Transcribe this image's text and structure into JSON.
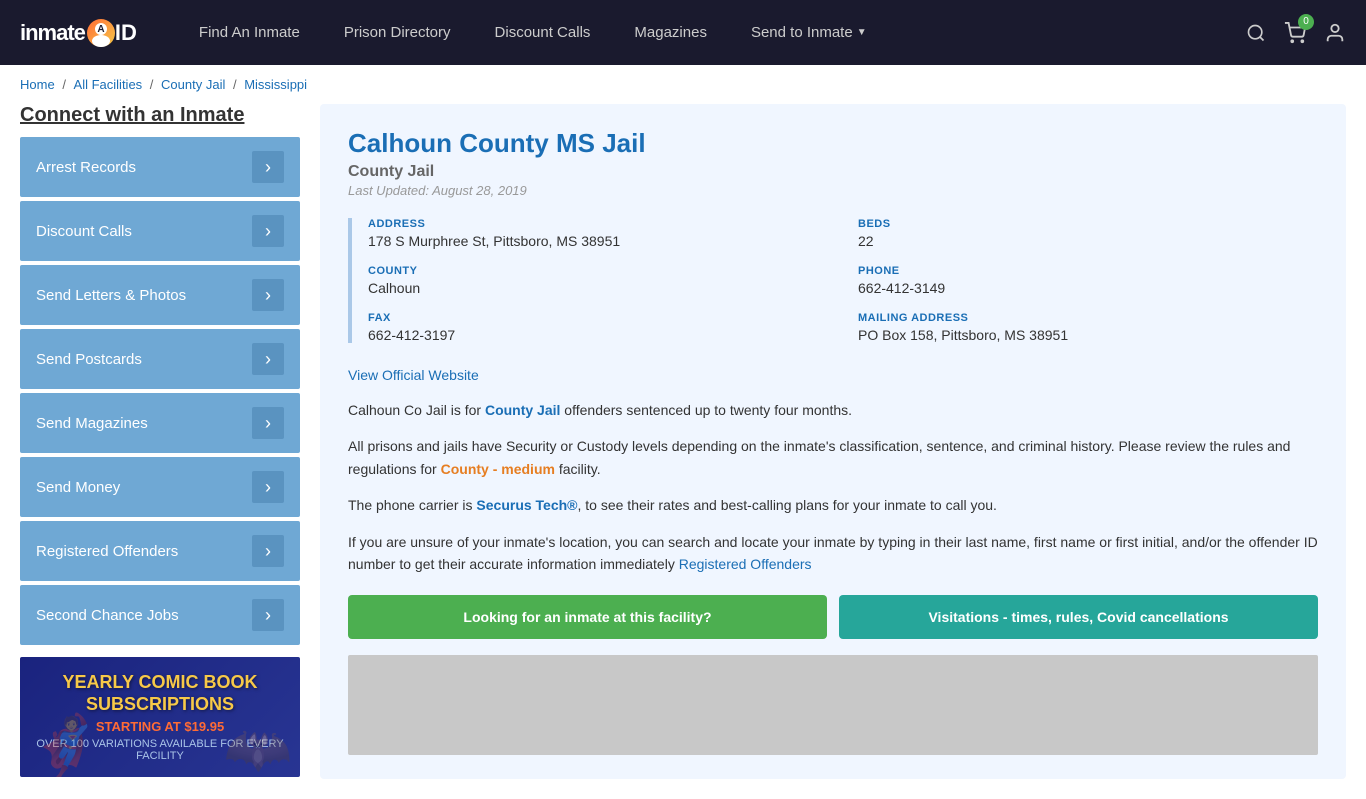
{
  "nav": {
    "logo": "inmateAID",
    "links": [
      {
        "id": "find-inmate",
        "label": "Find An Inmate",
        "arrow": false
      },
      {
        "id": "prison-directory",
        "label": "Prison Directory",
        "arrow": false
      },
      {
        "id": "discount-calls",
        "label": "Discount Calls",
        "arrow": false
      },
      {
        "id": "magazines",
        "label": "Magazines",
        "arrow": false
      },
      {
        "id": "send-to-inmate",
        "label": "Send to Inmate",
        "arrow": true
      }
    ],
    "cart_count": "0"
  },
  "breadcrumb": {
    "home": "Home",
    "all_facilities": "All Facilities",
    "county_jail": "County Jail",
    "state": "Mississippi"
  },
  "sidebar": {
    "title": "Connect with an Inmate",
    "items": [
      {
        "id": "arrest-records",
        "label": "Arrest Records"
      },
      {
        "id": "discount-calls",
        "label": "Discount Calls"
      },
      {
        "id": "send-letters-photos",
        "label": "Send Letters & Photos"
      },
      {
        "id": "send-postcards",
        "label": "Send Postcards"
      },
      {
        "id": "send-magazines",
        "label": "Send Magazines"
      },
      {
        "id": "send-money",
        "label": "Send Money"
      },
      {
        "id": "registered-offenders",
        "label": "Registered Offenders"
      },
      {
        "id": "second-chance-jobs",
        "label": "Second Chance Jobs"
      }
    ],
    "ad": {
      "line1": "YEARLY COMIC BOOK",
      "line2": "SUBSCRIPTIONS",
      "line3": "STARTING AT $19.95",
      "line4": "OVER 100 VARIATIONS AVAILABLE FOR EVERY FACILITY"
    }
  },
  "facility": {
    "title": "Calhoun County MS Jail",
    "type": "County Jail",
    "last_updated": "Last Updated: August 28, 2019",
    "address_label": "ADDRESS",
    "address_value": "178 S Murphree St, Pittsboro, MS 38951",
    "beds_label": "BEDS",
    "beds_value": "22",
    "county_label": "COUNTY",
    "county_value": "Calhoun",
    "phone_label": "PHONE",
    "phone_value": "662-412-3149",
    "fax_label": "FAX",
    "fax_value": "662-412-3197",
    "mailing_label": "MAILING ADDRESS",
    "mailing_value": "PO Box 158, Pittsboro, MS 38951",
    "view_website": "View Official Website",
    "desc1": "Calhoun Co Jail is for County Jail offenders sentenced up to twenty four months.",
    "desc2": "All prisons and jails have Security or Custody levels depending on the inmate's classification, sentence, and criminal history. Please review the rules and regulations for County - medium facility.",
    "desc3": "The phone carrier is Securus Tech®, to see their rates and best-calling plans for your inmate to call you.",
    "desc4": "If you are unsure of your inmate's location, you can search and locate your inmate by typing in their last name, first name or first initial, and/or the offender ID number to get their accurate information immediately Registered Offenders",
    "btn1": "Looking for an inmate at this facility?",
    "btn2": "Visitations - times, rules, Covid cancellations"
  }
}
